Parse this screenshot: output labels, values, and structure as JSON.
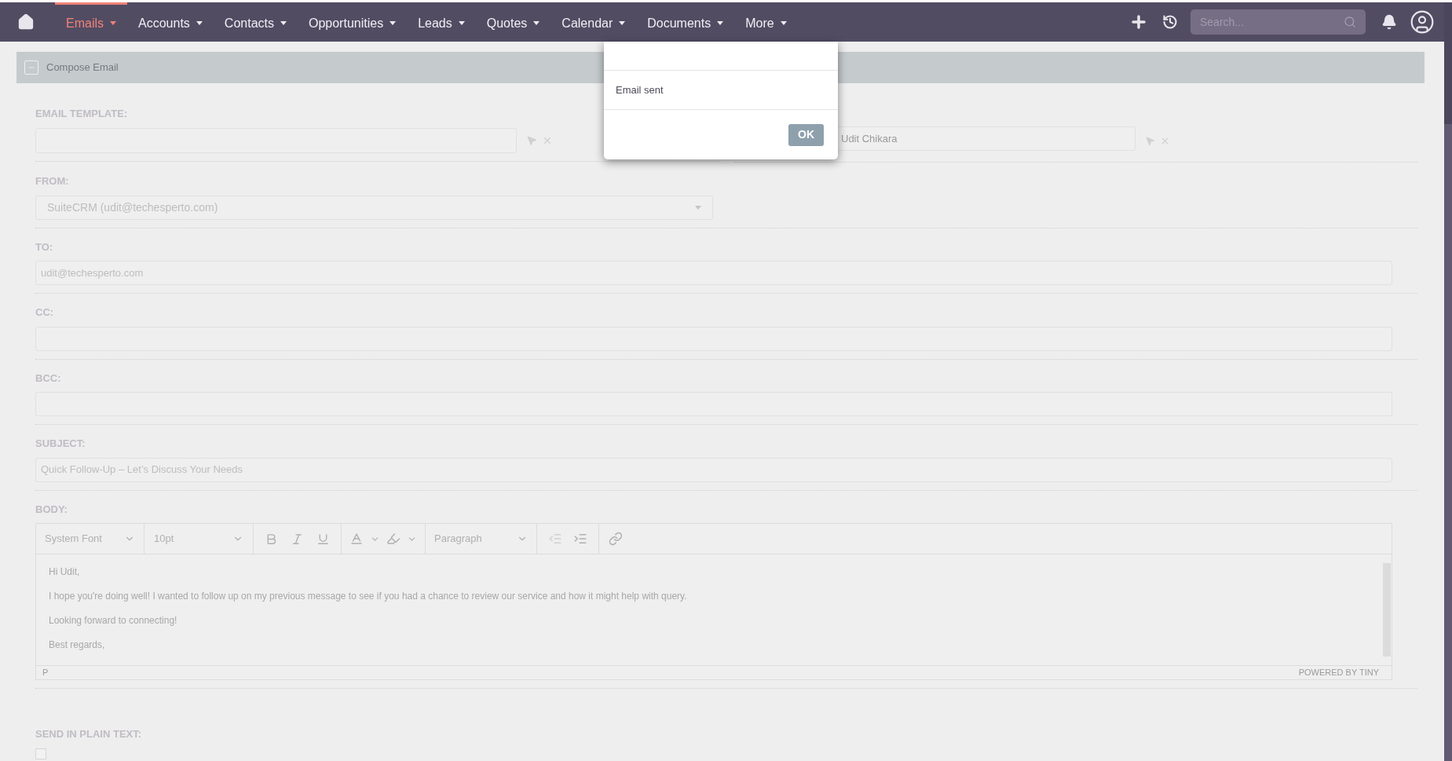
{
  "nav": {
    "items": [
      {
        "label": "Emails",
        "selected": true
      },
      {
        "label": "Accounts",
        "selected": false
      },
      {
        "label": "Contacts",
        "selected": false
      },
      {
        "label": "Opportunities",
        "selected": false
      },
      {
        "label": "Leads",
        "selected": false
      },
      {
        "label": "Quotes",
        "selected": false
      },
      {
        "label": "Calendar",
        "selected": false
      },
      {
        "label": "Documents",
        "selected": false
      },
      {
        "label": "More",
        "selected": false
      }
    ],
    "search": {
      "placeholder": "Search..."
    }
  },
  "panel": {
    "title": "Compose Email"
  },
  "template": {
    "label": "EMAIL TEMPLATE:"
  },
  "assigned": {
    "value": "Udit Chikara"
  },
  "fields": [
    {
      "label": "FROM:",
      "kind": "select",
      "value": "SuiteCRM (udit@techesperto.com)"
    },
    {
      "label": "TO:",
      "kind": "text",
      "value": "udit@techesperto.com"
    },
    {
      "label": "CC:",
      "kind": "text"
    },
    {
      "label": "BCC:",
      "kind": "text"
    },
    {
      "label": "SUBJECT:",
      "kind": "text",
      "value": "Quick Follow-Up – Let’s Discuss Your Needs"
    }
  ],
  "body": {
    "label": "BODY:",
    "font": "System Font",
    "size": "10pt",
    "block": "Paragraph",
    "paragraphs": [
      "Hi Udit,",
      "I hope you're doing well! I wanted to follow up on my previous message to see if you had a chance to review our service and how it might help with query.",
      "Looking forward to connecting!",
      "Best regards,"
    ],
    "path": "P",
    "branding": "POWERED BY TINY"
  },
  "plain_text": {
    "label": "SEND IN PLAIN TEXT:",
    "checked": false
  },
  "dialog": {
    "message": "Email sent",
    "button": "OK"
  }
}
